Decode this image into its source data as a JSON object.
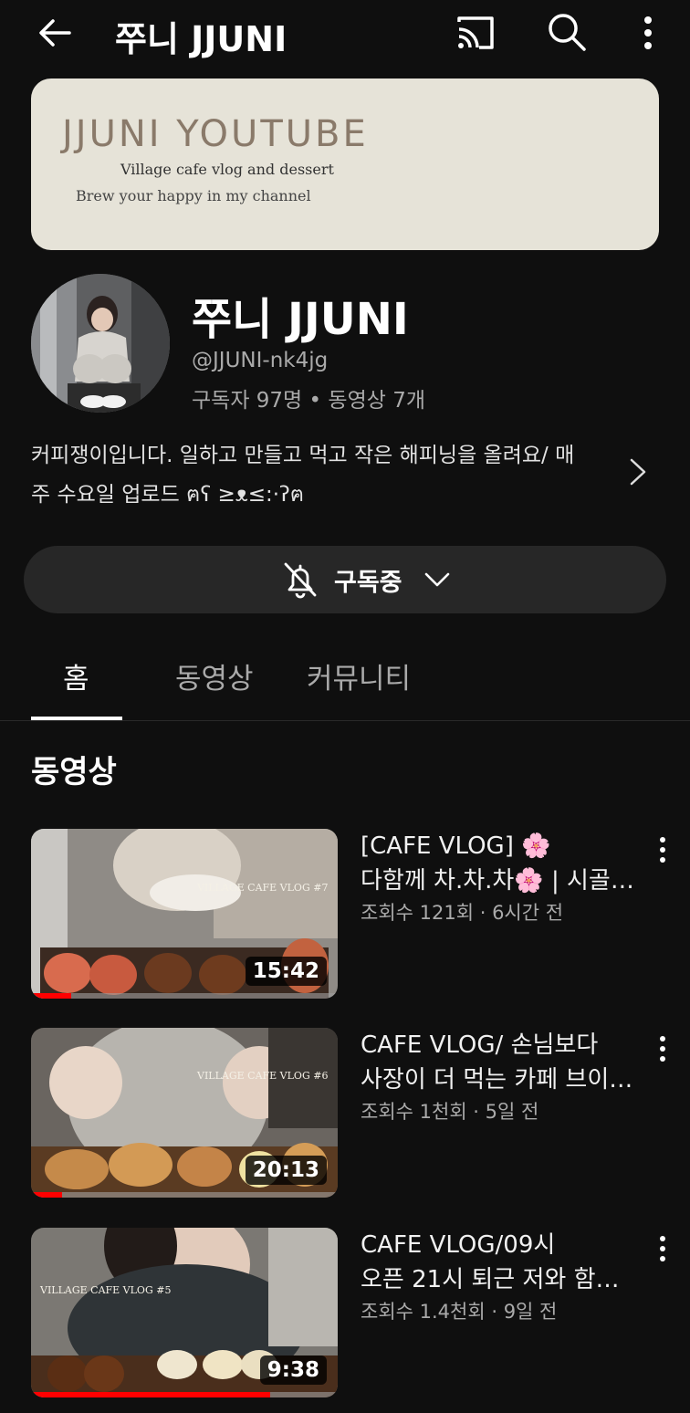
{
  "header": {
    "title": "쭈니 JJUNI",
    "back_icon": "arrow-left-icon",
    "cast_icon": "cast-icon",
    "search_icon": "search-icon",
    "more_icon": "more-vertical-icon"
  },
  "banner": {
    "line1": "JJUNI YOUTUBE",
    "line2": "Village cafe vlog and dessert",
    "line3": "Brew your happy in my channel"
  },
  "channel": {
    "name": "쭈니 JJUNI",
    "handle": "@JJUNI-nk4jg",
    "stats": "구독자 97명 • 동영상 7개",
    "description_line1": "커피쟁이입니다. 일하고 만들고 먹고 작은 해피닝을 올려요/ 매",
    "description_line2": "주 수요일 업로드 ฅʕ ≥ᴥ≤:·ʔฅ"
  },
  "subscribe": {
    "label": "구독중",
    "bell_icon": "bell-off-icon",
    "chevron_icon": "chevron-down-icon"
  },
  "tabs": [
    {
      "label": "홈",
      "active": true
    },
    {
      "label": "동영상",
      "active": false
    },
    {
      "label": "커뮤니티",
      "active": false
    }
  ],
  "section": {
    "title": "동영상"
  },
  "videos": [
    {
      "title_line1": "[CAFE VLOG] 🌸",
      "title_line2": "다함께 차.차.차🌸 | 시골…",
      "meta": "조회수 121회 · 6시간 전",
      "duration": "15:42",
      "progress": 0.13,
      "thumb_text": "VILLAGE CAFE VLOG #7"
    },
    {
      "title_line1": "CAFE VLOG/ 손님보다",
      "title_line2": "사장이 더 먹는 카페 브이…",
      "meta": "조회수 1천회 · 5일 전",
      "duration": "20:13",
      "progress": 0.1,
      "thumb_text": "VILLAGE CAFE VLOG #6"
    },
    {
      "title_line1": "CAFE VLOG/09시",
      "title_line2": "오픈 21시 퇴근 저와 함…",
      "meta": "조회수 1.4천회 · 9일 전",
      "duration": "9:38",
      "progress": 0.78,
      "thumb_text": "VILLAGE CAFE VLOG #5"
    }
  ],
  "colors": {
    "background": "#0f0f0f",
    "accent_progress": "#ff0000",
    "banner_bg": "#e6e3d8"
  }
}
